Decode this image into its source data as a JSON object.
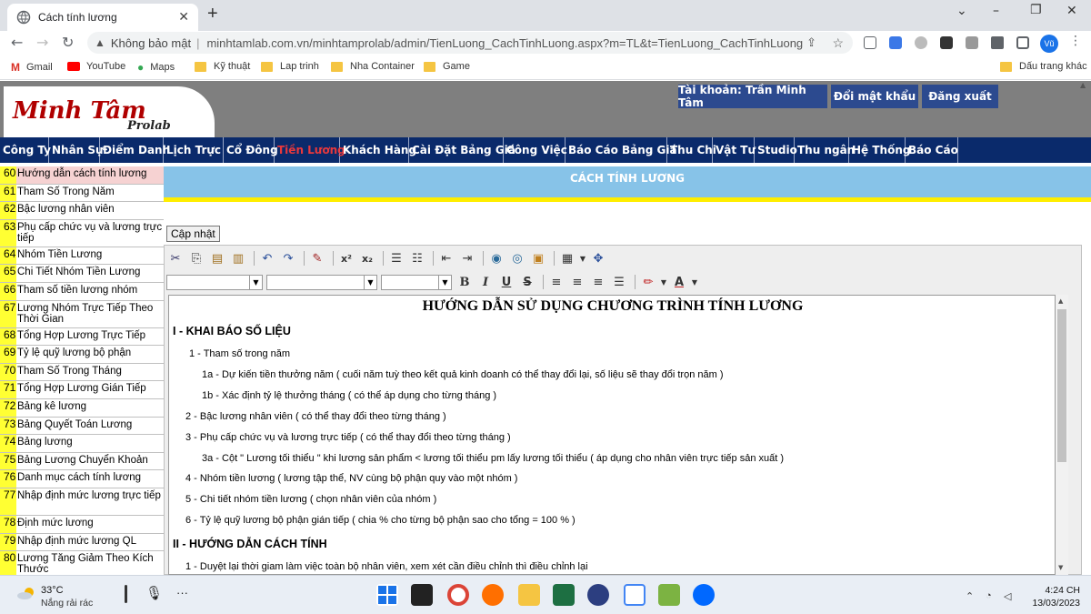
{
  "browser": {
    "tab_title": "Cách tính lương",
    "new_tab": "+",
    "insecure_label": "Không bảo mật",
    "separator": "|",
    "url": "minhtamlab.com.vn/minhtamprolab/admin/TienLuong_CachTinhLuong.aspx?m=TL&t=TienLuong_CachTinhLuong",
    "avatar": "Vũ"
  },
  "bookmarks": {
    "items": [
      "Gmail",
      "YouTube",
      "Maps",
      "Kỹ thuật",
      "Lap trinh",
      "Nha Container",
      "Game"
    ],
    "other": "Dấu trang khác"
  },
  "header": {
    "logo_main": "Minh Tâm",
    "logo_sub": "Prolab",
    "account": "Tài khoản: Trần Minh Tâm",
    "change_password": "Đổi mật khẩu",
    "logout": "Đăng xuất"
  },
  "menu": {
    "items": [
      "Công Ty",
      "Nhân Sự",
      "Điểm Danh",
      "Lịch Trực",
      "Cổ Đông",
      "Tiền Lương",
      "Khách Hàng",
      "Cài Đặt Bảng Giá",
      "Công Việc",
      "Báo Cáo Bảng Giá",
      "Thu Chi",
      "Vật Tư",
      "Studio",
      "Thu ngân",
      "Hệ Thống",
      "Báo Cáo"
    ],
    "active_index": 5
  },
  "sidebar": {
    "items": [
      {
        "num": "60",
        "label": "Hướng dẫn cách tính lương"
      },
      {
        "num": "61",
        "label": "Tham Số Trong Năm"
      },
      {
        "num": "62",
        "label": "Bậc lương nhân viên"
      },
      {
        "num": "63",
        "label": "Phụ cấp chức vụ và lương trực tiếp"
      },
      {
        "num": "64",
        "label": "Nhóm Tiền Lương"
      },
      {
        "num": "65",
        "label": "Chi Tiết Nhóm Tiền Lương"
      },
      {
        "num": "66",
        "label": "Tham số tiền lương nhóm"
      },
      {
        "num": "67",
        "label": "Lương Nhóm Trực Tiếp Theo Thời Gian"
      },
      {
        "num": "68",
        "label": "Tổng Hợp Lương Trực Tiếp"
      },
      {
        "num": "69",
        "label": "Tỷ lệ quỹ lương bộ phận"
      },
      {
        "num": "70",
        "label": "Tham Số Trong Tháng"
      },
      {
        "num": "71",
        "label": "Tổng Hợp Lương Gián Tiếp"
      },
      {
        "num": "72",
        "label": "Bảng kê lương"
      },
      {
        "num": "73",
        "label": "Bảng Quyết Toán Lương"
      },
      {
        "num": "74",
        "label": "Bảng lương"
      },
      {
        "num": "75",
        "label": "Bảng Lương Chuyển Khoản"
      },
      {
        "num": "76",
        "label": "Danh mục cách tính lương"
      },
      {
        "num": "77",
        "label": "Nhập định mức lương trực tiếp"
      },
      {
        "num": "78",
        "label": "Định mức lương"
      },
      {
        "num": "79",
        "label": "Nhập định mức lương QL"
      },
      {
        "num": "80",
        "label": "Lương Tăng Giảm Theo Kích Thước"
      }
    ]
  },
  "content": {
    "title": "CÁCH TÍNH LƯƠNG",
    "update_button": "Cập nhật"
  },
  "editor": {
    "superscript": "x²",
    "subscript": "x₂",
    "bold": "B",
    "italic": "I",
    "underline": "U",
    "strike": "S",
    "font_color": "A"
  },
  "doc": {
    "title": "HƯỚNG DẪN SỬ DỤNG CHƯƠNG TRÌNH TÍNH LƯƠNG",
    "section1": "I - KHAI BÁO SỐ LIỆU",
    "s1_lines": [
      "1 - Tham số trong năm",
      "1a - Dự kiến tiền thưởng năm ( cuối năm tuỳ theo kết quả kinh doanh có thể thay đổi lại, số liệu sẽ thay đổi trọn năm )",
      "1b - Xác định tỷ lệ thưởng tháng ( có thể áp dụng cho từng tháng )",
      "2 - Bậc lương nhân viên ( có thể thay đổi theo từng tháng )",
      "3 - Phụ cấp chức vụ và lương trực tiếp ( có thể thay đổi theo từng tháng )",
      "3a - Cột \" Lương tối thiểu \" khi lương sản phẩm < lương tối thiểu pm lấy lương tối thiểu ( áp dụng cho nhân viên trực tiếp sản xuất )",
      "4 - Nhóm tiền lương ( lương tập thể, NV cùng bộ phận quy vào một nhóm )",
      "5 - Chi tiết nhóm tiền lương ( chọn nhân viên của nhóm )",
      "6 - Tỷ lệ quỹ lương bộ phận gián tiếp ( chia % cho từng bộ phận sao cho tổng = 100 % )"
    ],
    "section2": "II - HƯỚNG DẪN CÁCH TÍNH",
    "s2_lines": [
      "1 - Duyệt lại thời giam làm việc toàn bộ nhân viên, xem xét cần điều chỉnh thì điều chỉnh lại"
    ]
  },
  "taskbar": {
    "temp": "33°C",
    "weather": "Nắng rải rác",
    "time": "4:24 CH",
    "date": "13/03/2023"
  }
}
